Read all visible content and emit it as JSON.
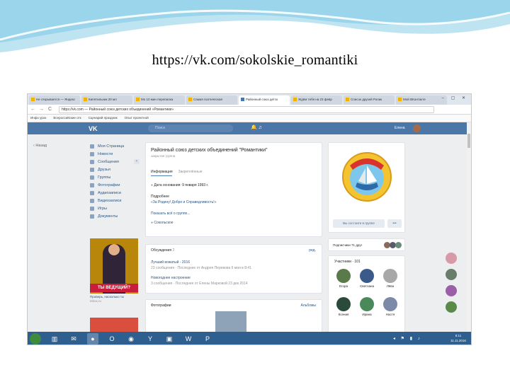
{
  "caption_url": "https://vk.com/sokolskie_romantiki",
  "browser": {
    "tabs": [
      {
        "label": "Не открывается — Яндекс"
      },
      {
        "label": "Кипятильник 20 мл"
      },
      {
        "label": "Мо 10 мин перепалка"
      },
      {
        "label": "Самая поэтическая"
      },
      {
        "label": "Районный союз детск",
        "active": true
      },
      {
        "label": "Ждём тебя на 23 февр"
      },
      {
        "label": "Список друзей Ролик"
      },
      {
        "label": "Мой ВКонтакте"
      }
    ],
    "window_controls": "– ▢ ✕",
    "nav_back": "←",
    "nav_forward": "→",
    "nav_reload": "C",
    "address": "https://vk.com — Районный союз детских объединений «Романтики»",
    "bookmarks": [
      "Инфо урок",
      "Всероссийские отк",
      "Сценарий праздник",
      "Опыт проектной"
    ]
  },
  "vk": {
    "logo": "VK",
    "search_placeholder": "Поиск",
    "header_icons": "🔔  ♫",
    "user_name": "Елена",
    "back_link": "‹ Назад",
    "menu": [
      {
        "label": "Моя Страница",
        "icon": "home-icon"
      },
      {
        "label": "Новости",
        "icon": "news-icon"
      },
      {
        "label": "Сообщения",
        "icon": "message-icon",
        "plus": "+"
      },
      {
        "label": "Друзья",
        "icon": "friends-icon"
      },
      {
        "label": "Группы",
        "icon": "groups-icon"
      },
      {
        "label": "Фотографии",
        "icon": "camera-icon"
      },
      {
        "label": "Аудиозаписи",
        "icon": "music-icon"
      },
      {
        "label": "Видеозаписи",
        "icon": "video-icon"
      },
      {
        "label": "Игры",
        "icon": "games-icon"
      },
      {
        "label": "Документы",
        "icon": "documents-icon"
      }
    ],
    "ad": {
      "banner": "ТЫ ВЕДУЩИЙ?",
      "text": "Проверь, насколько ты",
      "source": "inbox.ru"
    },
    "group": {
      "title": "Районный союз детских объединений \"Романтики\"",
      "subtitle": "закрытая группа",
      "tab_info": "Информация",
      "tab_news": "Закреплённые",
      "founded": "Дата основания: 9 января 1993 г.",
      "description_label": "Подробнее",
      "description": "«За Родину! Добро и Справедливость!»",
      "show_more": "Показать всё о группе...",
      "location": "Сокольское",
      "join_button": "Вы состоите в группе",
      "more_button": "•••",
      "logo_text": "РОМАНТИКИ"
    },
    "board": {
      "header": "Обсуждения",
      "count": "2",
      "edit": "ред.",
      "topics": [
        {
          "title": "Лучший вожатый - 2016",
          "meta": "23 сообщения · Последнее от Андрея Перевова 6 мая в 8:41"
        },
        {
          "title": "Новогоднее настроение",
          "meta": "3 сообщения · Последнее от Елены Марковой 23 дек 2014"
        }
      ]
    },
    "photos": {
      "header": "Фотографии",
      "albums": "Альбомы"
    },
    "subscribers": {
      "label": "Подписчики 71 друг"
    },
    "members": {
      "header": "Участники · 101",
      "people": [
        {
          "name": "Егора"
        },
        {
          "name": "Светлана"
        },
        {
          "name": "Лёва"
        },
        {
          "name": "Ксения"
        },
        {
          "name": "Ирина"
        },
        {
          "name": "Настя"
        }
      ]
    },
    "bottom_icons": "✎  ⌂"
  },
  "taskbar": {
    "apps": [
      {
        "glyph": "▥",
        "icon": "explorer-icon"
      },
      {
        "glyph": "✉",
        "icon": "mail-icon"
      },
      {
        "glyph": "●",
        "icon": "chrome-icon",
        "active": true
      },
      {
        "glyph": "O",
        "icon": "opera-icon"
      },
      {
        "glyph": "◉",
        "icon": "firefox-icon"
      },
      {
        "glyph": "Y",
        "icon": "yandex-icon"
      },
      {
        "glyph": "▣",
        "icon": "camera-app-icon"
      },
      {
        "glyph": "W",
        "icon": "word-icon"
      },
      {
        "glyph": "P",
        "icon": "powerpoint-icon"
      }
    ],
    "tray": "◂ ⚑ ▮ ♪",
    "time": "8:11",
    "date": "11.11.2016"
  }
}
